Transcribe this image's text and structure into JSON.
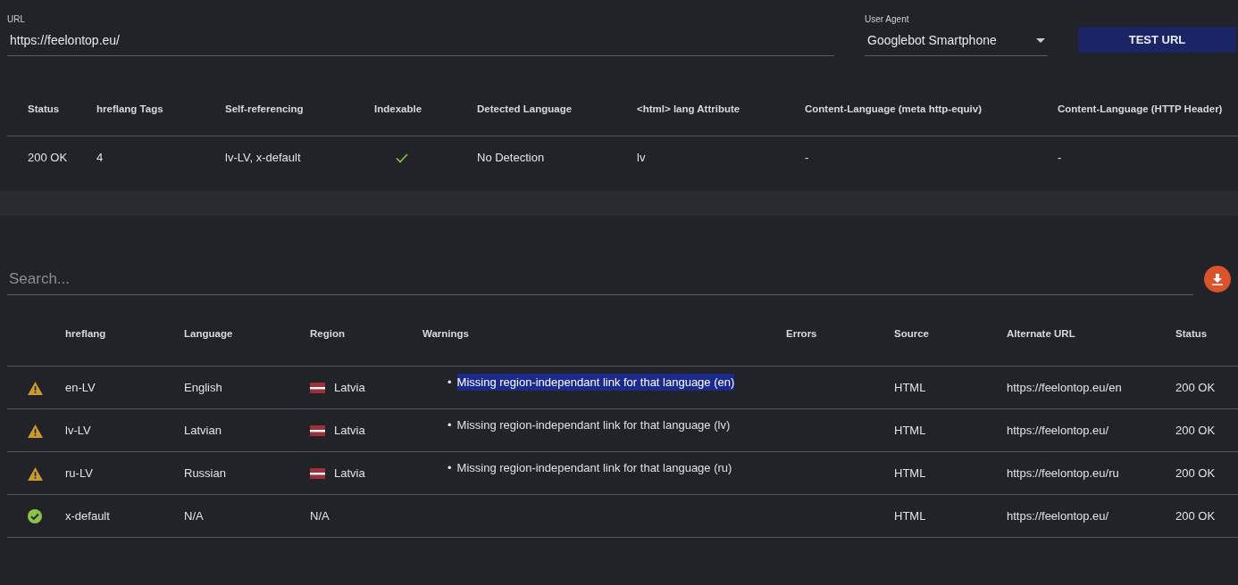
{
  "url_field": {
    "label": "URL",
    "value": "https://feelontop.eu/"
  },
  "user_agent": {
    "label": "User Agent",
    "value": "Googlebot Smartphone"
  },
  "test_button": "TEST URL",
  "summary": {
    "columns": [
      "Status",
      "hreflang Tags",
      "Self-referencing",
      "Indexable",
      "Detected Language",
      "<html> lang Attribute",
      "Content-Language (meta http-equiv)",
      "Content-Language (HTTP Header)"
    ],
    "row": {
      "status": "200 OK",
      "hreflang_tags": "4",
      "self_referencing": "lv-LV, x-default",
      "indexable": true,
      "detected_language": "No Detection",
      "html_lang": "lv",
      "content_language_meta": "-",
      "content_language_http": "-"
    }
  },
  "search": {
    "placeholder": "Search..."
  },
  "table": {
    "columns": [
      "hreflang",
      "Language",
      "Region",
      "Warnings",
      "Errors",
      "Source",
      "Alternate URL",
      "Status"
    ],
    "rows": [
      {
        "kind": "warning",
        "hreflang": "en-LV",
        "language": "English",
        "region": "Latvia",
        "has_flag": true,
        "warnings": [
          {
            "marker": "•",
            "text": "Missing region-independant link for that language (en)",
            "highlighted": true
          }
        ],
        "source": "HTML",
        "alternate_url": "https://feelontop.eu/en",
        "status": "200 OK"
      },
      {
        "kind": "warning",
        "hreflang": "lv-LV",
        "language": "Latvian",
        "region": "Latvia",
        "has_flag": true,
        "warnings": [
          {
            "marker": "•",
            "text": "Missing region-independant link for that language (lv)",
            "highlighted": false
          }
        ],
        "source": "HTML",
        "alternate_url": "https://feelontop.eu/",
        "status": "200 OK"
      },
      {
        "kind": "warning",
        "hreflang": "ru-LV",
        "language": "Russian",
        "region": "Latvia",
        "has_flag": true,
        "warnings": [
          {
            "marker": "•",
            "text": "Missing region-independant link for that language (ru)",
            "highlighted": false
          }
        ],
        "source": "HTML",
        "alternate_url": "https://feelontop.eu/ru",
        "status": "200 OK"
      },
      {
        "kind": "ok",
        "hreflang": "x-default",
        "language": "N/A",
        "region": "N/A",
        "has_flag": false,
        "warnings": [],
        "source": "HTML",
        "alternate_url": "https://feelontop.eu/",
        "status": "200 OK"
      }
    ]
  }
}
